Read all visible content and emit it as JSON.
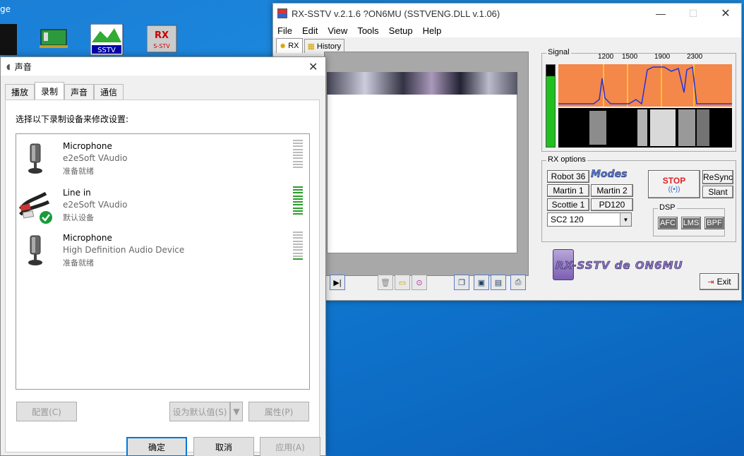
{
  "desktop": {
    "corner_text": "ge"
  },
  "rx": {
    "title": "RX-SSTV v.2.1.6 ?ON6MU (SSTVENG.DLL v.1.06)",
    "menu": [
      "File",
      "Edit",
      "View",
      "Tools",
      "Setup",
      "Help"
    ],
    "tabs": [
      "RX",
      "History"
    ],
    "signal": {
      "label": "Signal",
      "freq": [
        "1200",
        "1500",
        "1900",
        "2300"
      ]
    },
    "rxopts": {
      "label": "RX options",
      "modes": [
        "Robot 36",
        "Martin 1",
        "Martin 2",
        "Scottie 1",
        "PD120"
      ],
      "modes_logo": "Modes",
      "stop": "STOP",
      "resync": "ReSync",
      "slant": "Slant",
      "selected_mode": "SC2 120"
    },
    "dsp": {
      "label": "DSP",
      "buttons": [
        "AFC",
        "LMS",
        "BPF"
      ]
    },
    "logo": "RX-SSTV de ON6MU",
    "exit": "Exit",
    "colors": {
      "spectrum": "#f4874a",
      "level": "#20c020"
    }
  },
  "sound": {
    "title": "声音",
    "tabs": [
      "播放",
      "录制",
      "声音",
      "通信"
    ],
    "instruction": "选择以下录制设备来修改设置:",
    "devices": [
      {
        "name": "Microphone",
        "driver": "e2eSoft VAudio",
        "status": "准备就绪",
        "active": false
      },
      {
        "name": "Line in",
        "driver": "e2eSoft VAudio",
        "status": "默认设备",
        "active": true
      },
      {
        "name": "Microphone",
        "driver": "High Definition Audio Device",
        "status": "准备就绪",
        "active": false
      }
    ],
    "btn_configure": "配置(C)",
    "btn_default": "设为默认值(S)",
    "btn_props": "属性(P)",
    "btn_ok": "确定",
    "btn_cancel": "取消",
    "btn_apply": "应用(A)"
  }
}
